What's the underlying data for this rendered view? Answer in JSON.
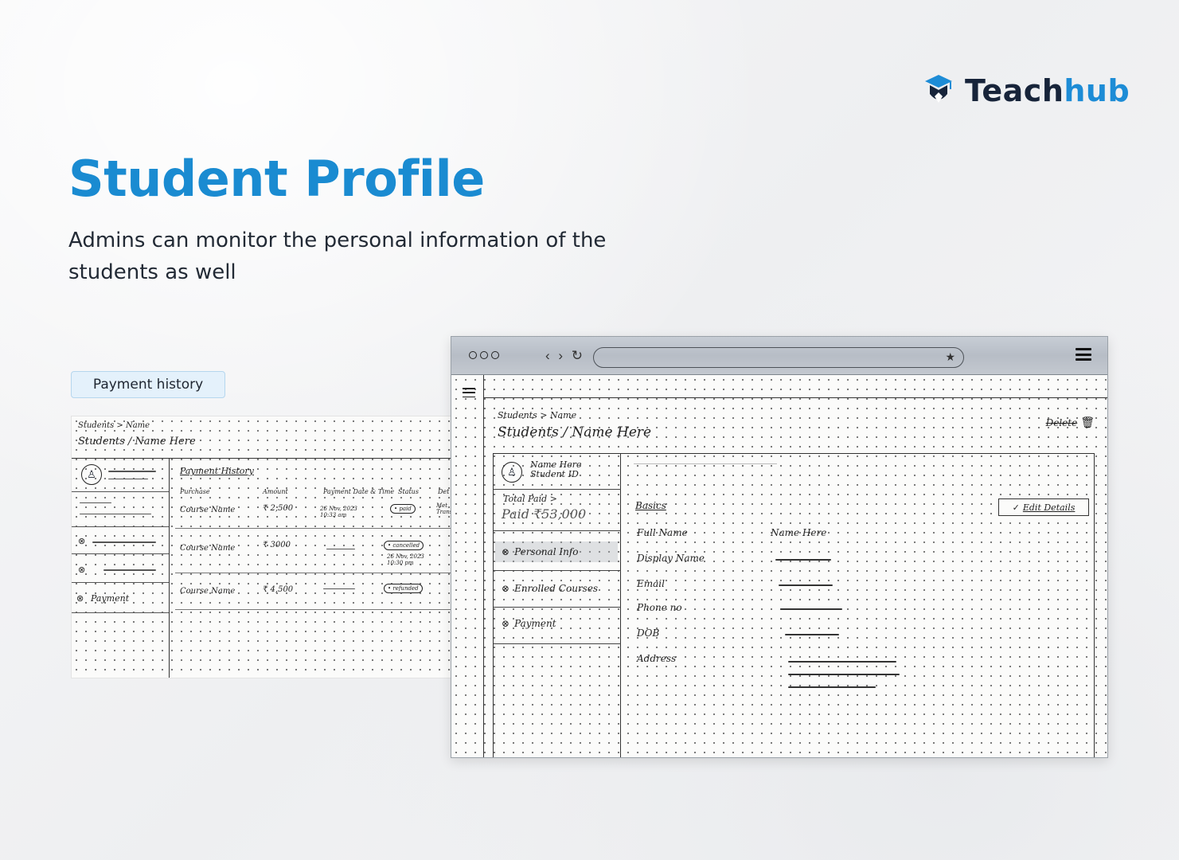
{
  "brand": {
    "name_part1": "Teach",
    "name_part2": "hub",
    "colors": {
      "dark": "#17243a",
      "accent": "#1d8cd6"
    }
  },
  "page": {
    "title": "Student Profile",
    "subtitle": "Admins can monitor the personal information of the students as well",
    "title_color": "#1a8bd1"
  },
  "tag": {
    "label": "Payment history"
  },
  "payment_sketch": {
    "breadcrumb": "Students > Name",
    "title": "Students / Name Here",
    "sidebar": {
      "payment_label": "Payment"
    },
    "table_title": "Payment History",
    "headers": [
      "Purchase",
      "Amount",
      "Payment Date & Time",
      "Status",
      "Det"
    ],
    "rows": [
      {
        "purchase": "Course Name",
        "amount": "₹ 2,500",
        "datetime": "26 Nov, 2023 10:33 am",
        "status": "• paid",
        "detail": "Met Trans"
      },
      {
        "purchase": "Course Name",
        "amount": "₹ 3000",
        "datetime": "26 Nov, 2023 10:30 pm",
        "status": "• cancelled",
        "detail": ""
      },
      {
        "purchase": "Course Name",
        "amount": "₹ 4,500",
        "datetime": "",
        "status": "• refunded",
        "detail": ""
      }
    ]
  },
  "browser": {
    "nav_icons": "‹ › ↻",
    "star_icon": "★",
    "breadcrumb": "Students > Name",
    "title": "Students / Name Here",
    "delete_label": "Delete",
    "sidebar": {
      "name": "Name Here",
      "student_id": "Student ID",
      "total_paid_label": "Total Paid >",
      "total_paid_value": "Paid ₹53,000",
      "items": [
        {
          "label": "Personal Info",
          "icon": "x-circle-icon"
        },
        {
          "label": "Enrolled Courses",
          "icon": "x-circle-icon"
        },
        {
          "label": "Payment",
          "icon": "x-circle-icon"
        }
      ]
    },
    "content": {
      "section": "Basics",
      "edit_label": "Edit Details",
      "fields": [
        {
          "label": "Full Name",
          "value": "Name Here"
        },
        {
          "label": "Display Name",
          "value": ""
        },
        {
          "label": "Email",
          "value": ""
        },
        {
          "label": "Phone no",
          "value": ""
        },
        {
          "label": "DOB",
          "value": ""
        },
        {
          "label": "Address",
          "value": ""
        }
      ]
    }
  }
}
